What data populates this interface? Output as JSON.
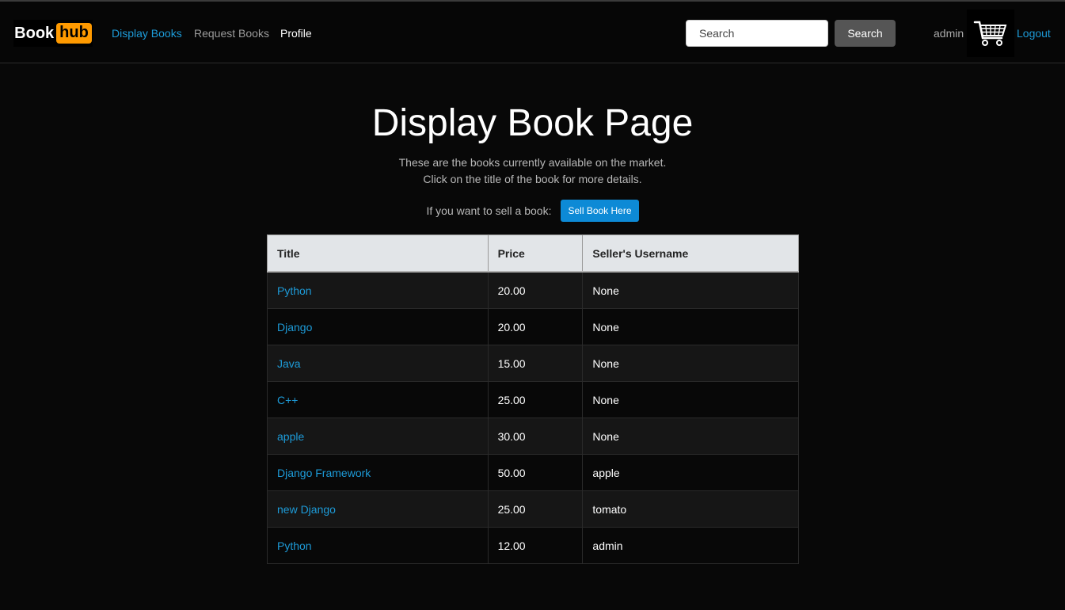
{
  "brand": {
    "book": "Book",
    "hub": "hub"
  },
  "nav": {
    "display_books": "Display Books",
    "request_books": "Request Books",
    "profile": "Profile"
  },
  "search": {
    "placeholder": "Search",
    "button": "Search"
  },
  "user": {
    "username": "admin",
    "logout": "Logout",
    "cart_icon": "shopping-cart-icon"
  },
  "main": {
    "title": "Display Book Page",
    "intro_line1": "These are the books currently available on the market.",
    "intro_line2": "Click on the title of the book for more details.",
    "sell_prompt": "If you want to sell a book:",
    "sell_button": "Sell Book Here"
  },
  "table": {
    "headers": [
      "Title",
      "Price",
      "Seller's Username"
    ],
    "rows": [
      {
        "title": "Python",
        "price": "20.00",
        "seller": "None"
      },
      {
        "title": "Django",
        "price": "20.00",
        "seller": "None"
      },
      {
        "title": "Java",
        "price": "15.00",
        "seller": "None"
      },
      {
        "title": "C++",
        "price": "25.00",
        "seller": "None"
      },
      {
        "title": "apple",
        "price": "30.00",
        "seller": "None"
      },
      {
        "title": "Django Framework",
        "price": "50.00",
        "seller": "apple"
      },
      {
        "title": "new Django",
        "price": "25.00",
        "seller": "tomato"
      },
      {
        "title": "Python",
        "price": "12.00",
        "seller": "admin"
      }
    ]
  },
  "colors": {
    "background": "#080808",
    "link": "#1d9bd8",
    "brand_accent": "#ff9a00",
    "sell_button": "#0d8ad6",
    "table_header": "#e2e5e8"
  }
}
